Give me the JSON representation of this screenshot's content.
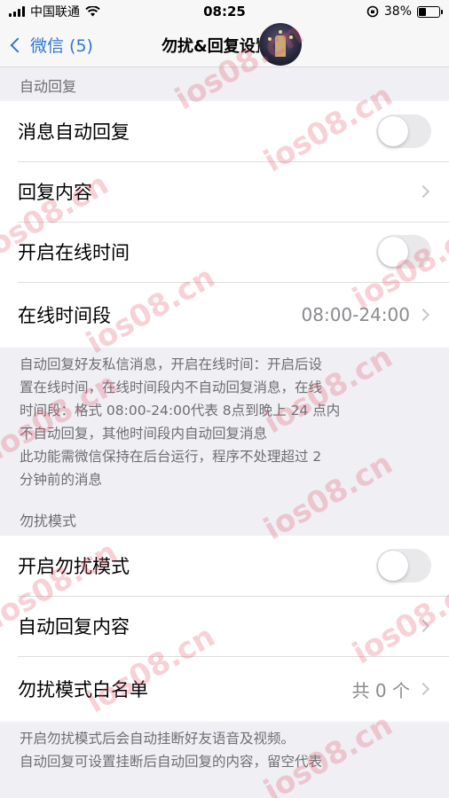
{
  "status_bar": {
    "carrier": "中国联通",
    "time": "08:25",
    "battery": "38%",
    "battery_level": 0.38
  },
  "nav": {
    "back_label": "微信 (5)",
    "title": "勿扰&回复设置"
  },
  "auto_reply": {
    "header": "自动回复",
    "items": [
      {
        "label": "消息自动回复"
      },
      {
        "label": "回复内容"
      },
      {
        "label": "开启在线时间"
      },
      {
        "label": "在线时间段",
        "value": "08:00-24:00"
      }
    ],
    "footer": [
      "自动回复好友私信消息，开启在线时间：开启后设",
      "置在线时间，在线时间段内不自动回复消息，在线",
      "时间段：格式 08:00-24:00代表 8点到晚上 24 点内",
      "不自动回复，其他时间段内自动回复消息",
      "此功能需微信保持在后台运行，程序不处理超过 2",
      "分钟前的消息"
    ]
  },
  "dnd": {
    "header": "勿扰模式",
    "items": [
      {
        "label": "开启勿扰模式"
      },
      {
        "label": "自动回复内容"
      },
      {
        "label": "勿扰模式白名单",
        "value": "共 0 个"
      }
    ],
    "footer": [
      "开启勿扰模式后会自动挂断好友语音及视频。",
      "自动回复可设置挂断后自动回复的内容，留空代表"
    ]
  },
  "watermark": "ios08.cn"
}
